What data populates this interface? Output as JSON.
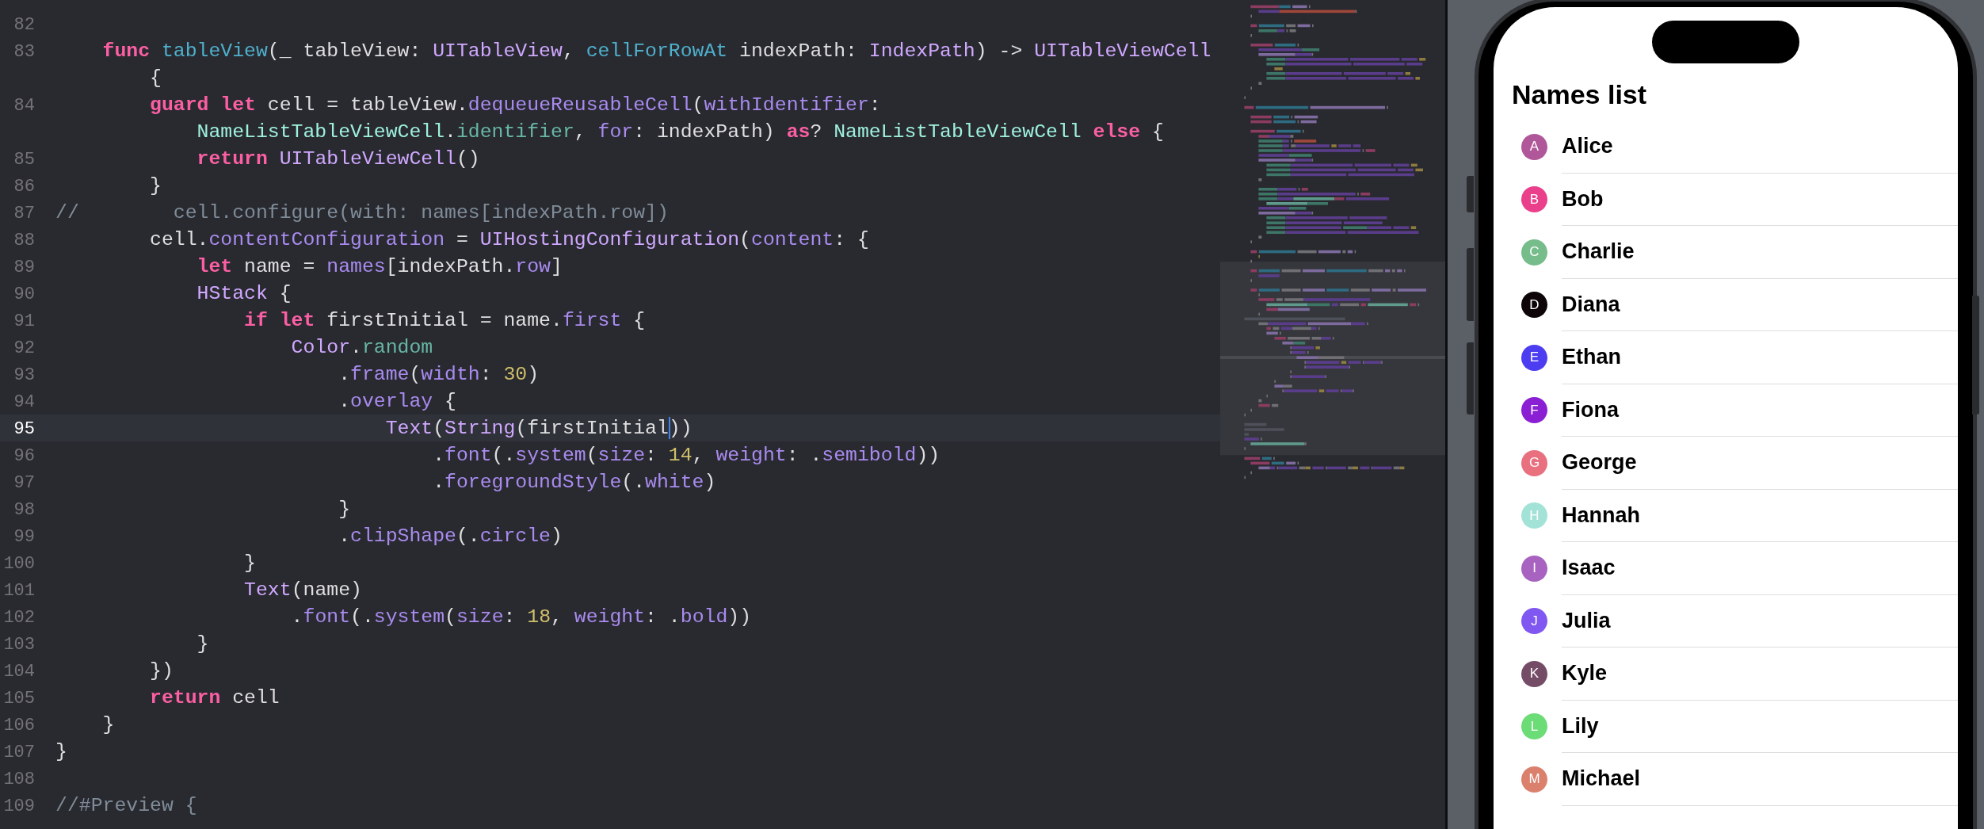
{
  "editor": {
    "rows": [
      {
        "number": "82",
        "current": false
      },
      {
        "number": "83",
        "current": false,
        "tokens": [
          {
            "text": "    func",
            "kind": "keyword"
          },
          {
            "text": " tableView",
            "kind": "declaration"
          },
          {
            "text": "(_ tableView: ",
            "kind": "plain"
          },
          {
            "text": "UITableView",
            "kind": "type"
          },
          {
            "text": ", ",
            "kind": "plain"
          },
          {
            "text": "cellForRowAt",
            "kind": "declaration"
          },
          {
            "text": " indexPath: ",
            "kind": "plain"
          },
          {
            "text": "IndexPath",
            "kind": "type"
          },
          {
            "text": ") -> ",
            "kind": "plain"
          },
          {
            "text": "UITableViewCell",
            "kind": "type"
          }
        ],
        "continuation": [
          {
            "text": "        {",
            "kind": "plain"
          }
        ]
      },
      {
        "number": "84",
        "current": false,
        "tokens": [
          {
            "text": "        guard",
            "kind": "keyword"
          },
          {
            "text": " let",
            "kind": "keyword"
          },
          {
            "text": " cell = tableView.",
            "kind": "plain"
          },
          {
            "text": "dequeueReusableCell",
            "kind": "method"
          },
          {
            "text": "(",
            "kind": "plain"
          },
          {
            "text": "withIdentifier",
            "kind": "method"
          },
          {
            "text": ":",
            "kind": "plain"
          }
        ],
        "continuation": [
          {
            "text": "            NameListTableViewCell",
            "kind": "project_type"
          },
          {
            "text": ".",
            "kind": "plain"
          },
          {
            "text": "identifier",
            "kind": "project_member"
          },
          {
            "text": ", ",
            "kind": "plain"
          },
          {
            "text": "for",
            "kind": "method"
          },
          {
            "text": ": indexPath) ",
            "kind": "plain"
          },
          {
            "text": "as",
            "kind": "keyword"
          },
          {
            "text": "? ",
            "kind": "plain"
          },
          {
            "text": "NameListTableViewCell",
            "kind": "project_type"
          },
          {
            "text": " else",
            "kind": "keyword"
          },
          {
            "text": " {",
            "kind": "plain"
          }
        ]
      },
      {
        "number": "85",
        "current": false,
        "tokens": [
          {
            "text": "            return",
            "kind": "keyword"
          },
          {
            "text": " UITableViewCell",
            "kind": "type"
          },
          {
            "text": "()",
            "kind": "plain"
          }
        ]
      },
      {
        "number": "86",
        "current": false,
        "tokens": [
          {
            "text": "        }",
            "kind": "plain"
          }
        ]
      },
      {
        "number": "87",
        "current": false,
        "tokens": [
          {
            "text": "//        cell.configure(with: names[indexPath.row])",
            "kind": "comment"
          }
        ]
      },
      {
        "number": "88",
        "current": false,
        "tokens": [
          {
            "text": "        cell.",
            "kind": "plain"
          },
          {
            "text": "contentConfiguration",
            "kind": "method"
          },
          {
            "text": " = ",
            "kind": "plain"
          },
          {
            "text": "UIHostingConfiguration",
            "kind": "type"
          },
          {
            "text": "(",
            "kind": "plain"
          },
          {
            "text": "content",
            "kind": "method"
          },
          {
            "text": ": {",
            "kind": "plain"
          }
        ]
      },
      {
        "number": "89",
        "current": false,
        "tokens": [
          {
            "text": "            let",
            "kind": "keyword"
          },
          {
            "text": " name = ",
            "kind": "plain"
          },
          {
            "text": "names",
            "kind": "method"
          },
          {
            "text": "[indexPath.",
            "kind": "plain"
          },
          {
            "text": "row",
            "kind": "method"
          },
          {
            "text": "]",
            "kind": "plain"
          }
        ]
      },
      {
        "number": "90",
        "current": false,
        "tokens": [
          {
            "text": "            HStack",
            "kind": "type"
          },
          {
            "text": " {",
            "kind": "plain"
          }
        ]
      },
      {
        "number": "91",
        "current": false,
        "tokens": [
          {
            "text": "                if",
            "kind": "keyword"
          },
          {
            "text": " let",
            "kind": "keyword"
          },
          {
            "text": " firstInitial = name.",
            "kind": "plain"
          },
          {
            "text": "first",
            "kind": "method"
          },
          {
            "text": " {",
            "kind": "plain"
          }
        ]
      },
      {
        "number": "92",
        "current": false,
        "tokens": [
          {
            "text": "                    Color",
            "kind": "type"
          },
          {
            "text": ".",
            "kind": "plain"
          },
          {
            "text": "random",
            "kind": "project_member"
          }
        ]
      },
      {
        "number": "93",
        "current": false,
        "tokens": [
          {
            "text": "                        .",
            "kind": "plain"
          },
          {
            "text": "frame",
            "kind": "method"
          },
          {
            "text": "(",
            "kind": "plain"
          },
          {
            "text": "width",
            "kind": "method"
          },
          {
            "text": ": ",
            "kind": "plain"
          },
          {
            "text": "30",
            "kind": "number"
          },
          {
            "text": ")",
            "kind": "plain"
          }
        ]
      },
      {
        "number": "94",
        "current": false,
        "tokens": [
          {
            "text": "                        .",
            "kind": "plain"
          },
          {
            "text": "overlay",
            "kind": "method"
          },
          {
            "text": " {",
            "kind": "plain"
          }
        ]
      },
      {
        "number": "95",
        "current": true,
        "tokens": [
          {
            "text": "                            Text",
            "kind": "type"
          },
          {
            "text": "(",
            "kind": "plain"
          },
          {
            "text": "String",
            "kind": "type"
          },
          {
            "text": "(firstInitial",
            "kind": "plain",
            "cursor": true
          },
          {
            "text": "))",
            "kind": "plain"
          }
        ]
      },
      {
        "number": "96",
        "current": false,
        "tokens": [
          {
            "text": "                                .",
            "kind": "plain"
          },
          {
            "text": "font",
            "kind": "method"
          },
          {
            "text": "(.",
            "kind": "plain"
          },
          {
            "text": "system",
            "kind": "method"
          },
          {
            "text": "(",
            "kind": "plain"
          },
          {
            "text": "size",
            "kind": "method"
          },
          {
            "text": ": ",
            "kind": "plain"
          },
          {
            "text": "14",
            "kind": "number"
          },
          {
            "text": ", ",
            "kind": "plain"
          },
          {
            "text": "weight",
            "kind": "method"
          },
          {
            "text": ": .",
            "kind": "plain"
          },
          {
            "text": "semibold",
            "kind": "method"
          },
          {
            "text": "))",
            "kind": "plain"
          }
        ]
      },
      {
        "number": "97",
        "current": false,
        "tokens": [
          {
            "text": "                                .",
            "kind": "plain"
          },
          {
            "text": "foregroundStyle",
            "kind": "method"
          },
          {
            "text": "(.",
            "kind": "plain"
          },
          {
            "text": "white",
            "kind": "method"
          },
          {
            "text": ")",
            "kind": "plain"
          }
        ]
      },
      {
        "number": "98",
        "current": false,
        "tokens": [
          {
            "text": "                        }",
            "kind": "plain"
          }
        ]
      },
      {
        "number": "99",
        "current": false,
        "tokens": [
          {
            "text": "                        .",
            "kind": "plain"
          },
          {
            "text": "clipShape",
            "kind": "method"
          },
          {
            "text": "(.",
            "kind": "plain"
          },
          {
            "text": "circle",
            "kind": "method"
          },
          {
            "text": ")",
            "kind": "plain"
          }
        ]
      },
      {
        "number": "100",
        "current": false,
        "tokens": [
          {
            "text": "                }",
            "kind": "plain"
          }
        ]
      },
      {
        "number": "101",
        "current": false,
        "tokens": [
          {
            "text": "                Text",
            "kind": "type"
          },
          {
            "text": "(name)",
            "kind": "plain"
          }
        ]
      },
      {
        "number": "102",
        "current": false,
        "tokens": [
          {
            "text": "                    .",
            "kind": "plain"
          },
          {
            "text": "font",
            "kind": "method"
          },
          {
            "text": "(.",
            "kind": "plain"
          },
          {
            "text": "system",
            "kind": "method"
          },
          {
            "text": "(",
            "kind": "plain"
          },
          {
            "text": "size",
            "kind": "method"
          },
          {
            "text": ": ",
            "kind": "plain"
          },
          {
            "text": "18",
            "kind": "number"
          },
          {
            "text": ", ",
            "kind": "plain"
          },
          {
            "text": "weight",
            "kind": "method"
          },
          {
            "text": ": .",
            "kind": "plain"
          },
          {
            "text": "bold",
            "kind": "method"
          },
          {
            "text": "))",
            "kind": "plain"
          }
        ]
      },
      {
        "number": "103",
        "current": false,
        "tokens": [
          {
            "text": "            }",
            "kind": "plain"
          }
        ]
      },
      {
        "number": "104",
        "current": false,
        "tokens": [
          {
            "text": "        })",
            "kind": "plain"
          }
        ]
      },
      {
        "number": "105",
        "current": false,
        "tokens": [
          {
            "text": "        return",
            "kind": "keyword"
          },
          {
            "text": " cell",
            "kind": "plain"
          }
        ]
      },
      {
        "number": "106",
        "current": false,
        "tokens": [
          {
            "text": "    }",
            "kind": "plain"
          }
        ]
      },
      {
        "number": "107",
        "current": false,
        "tokens": [
          {
            "text": "}",
            "kind": "plain"
          }
        ]
      },
      {
        "number": "108",
        "current": false
      },
      {
        "number": "109",
        "current": false,
        "tokens": [
          {
            "text": "//#Preview {",
            "kind": "comment"
          }
        ]
      }
    ]
  },
  "simulator": {
    "title": "Names list",
    "items": [
      {
        "initial": "A",
        "name": "Alice",
        "color": "#b0579a"
      },
      {
        "initial": "B",
        "name": "Bob",
        "color": "#ea3f8b"
      },
      {
        "initial": "C",
        "name": "Charlie",
        "color": "#77bd8b"
      },
      {
        "initial": "D",
        "name": "Diana",
        "color": "#0d0508"
      },
      {
        "initial": "E",
        "name": "Ethan",
        "color": "#4c3df0"
      },
      {
        "initial": "F",
        "name": "Fiona",
        "color": "#8a1fd3"
      },
      {
        "initial": "G",
        "name": "George",
        "color": "#e9707f"
      },
      {
        "initial": "H",
        "name": "Hannah",
        "color": "#a3e3d7"
      },
      {
        "initial": "I",
        "name": "Isaac",
        "color": "#a863c0"
      },
      {
        "initial": "J",
        "name": "Julia",
        "color": "#8057f0"
      },
      {
        "initial": "K",
        "name": "Kyle",
        "color": "#754c66"
      },
      {
        "initial": "L",
        "name": "Lily",
        "color": "#6cdc76"
      },
      {
        "initial": "M",
        "name": "Michael",
        "color": "#dc806e"
      }
    ]
  }
}
